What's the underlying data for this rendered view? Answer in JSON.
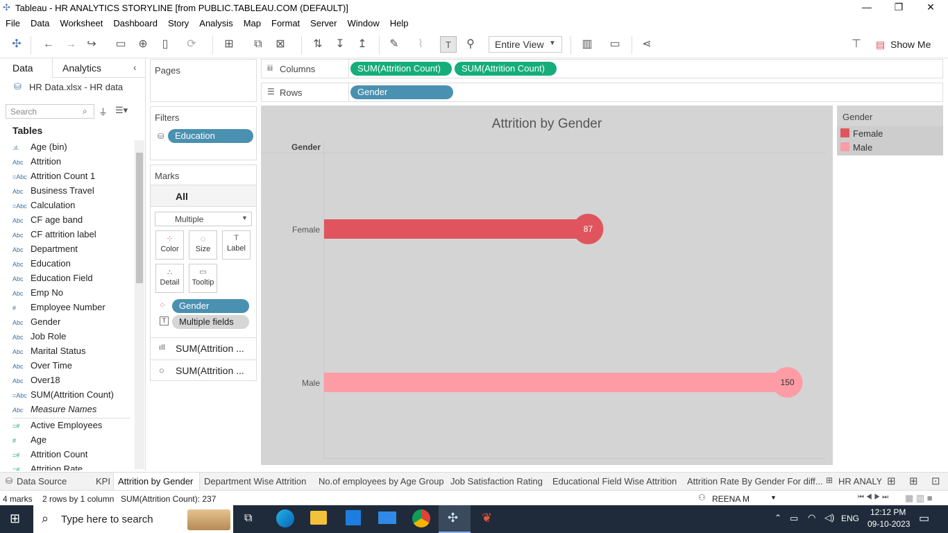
{
  "window": {
    "title": "Tableau - HR ANALYTICS STORYLINE [from PUBLIC.TABLEAU.COM (DEFAULT)]"
  },
  "menu": [
    "File",
    "Data",
    "Worksheet",
    "Dashboard",
    "Story",
    "Analysis",
    "Map",
    "Format",
    "Server",
    "Window",
    "Help"
  ],
  "toolbar": {
    "fit": "Entire View",
    "show_me": "Show Me"
  },
  "left_panel": {
    "tab_data": "Data",
    "tab_analytics": "Analytics",
    "source": "HR Data.xlsx - HR data",
    "search_placeholder": "Search",
    "tables_label": "Tables",
    "fields": [
      {
        "icon": ".ıl.",
        "name": "Age (bin)"
      },
      {
        "icon": "Abc",
        "name": "Attrition"
      },
      {
        "icon": "=Abc",
        "name": "Attrition Count 1"
      },
      {
        "icon": "Abc",
        "name": "Business Travel"
      },
      {
        "icon": "=Abc",
        "name": "Calculation"
      },
      {
        "icon": "Abc",
        "name": "CF age band"
      },
      {
        "icon": "Abc",
        "name": "CF attrition label"
      },
      {
        "icon": "Abc",
        "name": "Department"
      },
      {
        "icon": "Abc",
        "name": "Education"
      },
      {
        "icon": "Abc",
        "name": "Education Field"
      },
      {
        "icon": "Abc",
        "name": "Emp No"
      },
      {
        "icon": "#",
        "name": "Employee Number"
      },
      {
        "icon": "Abc",
        "name": "Gender"
      },
      {
        "icon": "Abc",
        "name": "Job Role"
      },
      {
        "icon": "Abc",
        "name": "Marital Status"
      },
      {
        "icon": "Abc",
        "name": "Over Time"
      },
      {
        "icon": "Abc",
        "name": "Over18"
      },
      {
        "icon": "=Abc",
        "name": "SUM(Attrition Count)"
      },
      {
        "icon": "Abc",
        "name": "Measure Names"
      }
    ],
    "measures": [
      {
        "icon": "=#",
        "name": "Active Employees"
      },
      {
        "icon": "#",
        "name": "Age"
      },
      {
        "icon": "=#",
        "name": "Attrition Count"
      },
      {
        "icon": "=#",
        "name": "Attrition Rate"
      }
    ]
  },
  "pages": {
    "label": "Pages"
  },
  "filters": {
    "label": "Filters",
    "items": [
      "Education"
    ]
  },
  "marks": {
    "label": "Marks",
    "all": "All",
    "type": "Multiple",
    "buttons": [
      "Color",
      "Size",
      "Label",
      "Detail",
      "Tooltip"
    ],
    "pills": [
      "Gender",
      "Multiple fields"
    ],
    "subs": [
      "SUM(Attrition ...",
      "SUM(Attrition ..."
    ]
  },
  "shelves": {
    "columns_label": "Columns",
    "columns": [
      "SUM(Attrition Count)",
      "SUM(Attrition Count)"
    ],
    "rows_label": "Rows",
    "rows": [
      "Gender"
    ]
  },
  "chart_data": {
    "type": "bar",
    "title": "Attrition by Gender",
    "row_header": "Gender",
    "categories": [
      "Female",
      "Male"
    ],
    "values": [
      87,
      150
    ],
    "colors": [
      "#e0555d",
      "#fd9ca5"
    ],
    "xlim": [
      0,
      158
    ]
  },
  "legend": {
    "title": "Gender",
    "items": [
      {
        "label": "Female",
        "color": "#e0555d"
      },
      {
        "label": "Male",
        "color": "#fd9ca5"
      }
    ]
  },
  "sheet_tabs": [
    "Data Source",
    "KPI",
    "Attrition by Gender",
    "Department Wise Attrition",
    "No.of employees by Age Group",
    "Job Satisfaction Rating",
    "Educational Field Wise Attrition",
    "Attrition Rate By Gender For diff...",
    "HR ANALYT"
  ],
  "status": {
    "marks": "4 marks",
    "rows": "2 rows by 1 column",
    "sum": "SUM(Attrition Count): 237",
    "user": "REENA M"
  },
  "taskbar": {
    "search": "Type here to search",
    "lang": "ENG",
    "time": "12:12 PM",
    "date": "09-10-2023"
  }
}
